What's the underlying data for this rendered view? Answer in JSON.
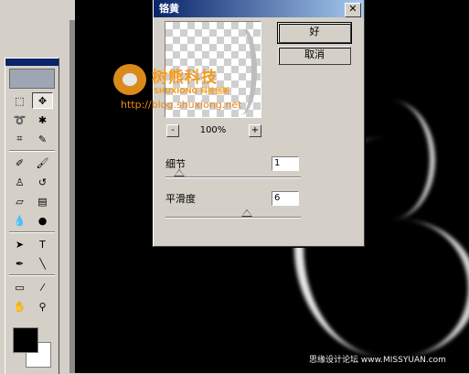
{
  "dialog": {
    "title": "铬黄",
    "close_glyph": "✕",
    "ok_label": "好",
    "cancel_label": "取消",
    "zoom": {
      "minus": "-",
      "value": "100%",
      "plus": "+"
    },
    "params": [
      {
        "label": "细节",
        "value": "1",
        "slider_fraction": 0.1
      },
      {
        "label": "平滑度",
        "value": "6",
        "slider_fraction": 0.6
      }
    ]
  },
  "watermark": {
    "brand": "树熊科技",
    "sub": "SHUXIONG 科技创新",
    "url": "http://blog.shuxiong.net",
    "bottom_text": "思缘设计论坛",
    "bottom_url": "www.MISSYUAN.com"
  },
  "tools": [
    [
      "marquee-icon",
      "move-icon"
    ],
    [
      "lasso-icon",
      "magic-wand-icon"
    ],
    [
      "crop-icon",
      "slice-icon"
    ],
    [
      "healing-brush-icon",
      "brush-icon"
    ],
    [
      "clone-stamp-icon",
      "history-brush-icon"
    ],
    [
      "eraser-icon",
      "gradient-icon"
    ],
    [
      "blur-icon",
      "dodge-icon"
    ],
    [
      "path-select-icon",
      "type-icon"
    ],
    [
      "pen-icon",
      "line-icon"
    ],
    [
      "notes-icon",
      "eyedropper-icon"
    ],
    [
      "hand-icon",
      "zoom-icon"
    ]
  ],
  "tool_glyphs": {
    "marquee-icon": "⬚",
    "move-icon": "✥",
    "lasso-icon": "➰",
    "magic-wand-icon": "✱",
    "crop-icon": "⌗",
    "slice-icon": "✎",
    "healing-brush-icon": "✐",
    "brush-icon": "🖌",
    "clone-stamp-icon": "♙",
    "history-brush-icon": "↺",
    "eraser-icon": "▱",
    "gradient-icon": "▤",
    "blur-icon": "💧",
    "dodge-icon": "●",
    "path-select-icon": "➤",
    "type-icon": "T",
    "pen-icon": "✒",
    "line-icon": "╲",
    "notes-icon": "▭",
    "eyedropper-icon": "⁄",
    "hand-icon": "✋",
    "zoom-icon": "⚲"
  },
  "colors": {
    "titlebar": "#0a246a",
    "watermark_orange": "#f29a1f",
    "foreground": "#000000",
    "background": "#ffffff"
  }
}
